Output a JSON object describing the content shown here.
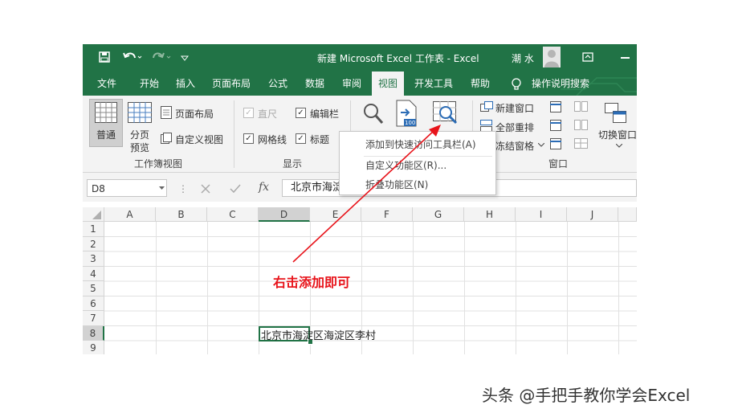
{
  "titlebar": {
    "title": "新建 Microsoft Excel 工作表 - Excel",
    "user": "潮 水"
  },
  "tabs": [
    {
      "label": "文件",
      "active": false
    },
    {
      "label": "开始",
      "active": false
    },
    {
      "label": "插入",
      "active": false
    },
    {
      "label": "页面布局",
      "active": false
    },
    {
      "label": "公式",
      "active": false
    },
    {
      "label": "数据",
      "active": false
    },
    {
      "label": "审阅",
      "active": false
    },
    {
      "label": "视图",
      "active": true
    },
    {
      "label": "开发工具",
      "active": false
    },
    {
      "label": "帮助",
      "active": false
    }
  ],
  "tell_me": "操作说明搜索",
  "ribbon": {
    "workbook_views": {
      "normal": "普通",
      "page_break_1": "分页",
      "page_break_2": "预览",
      "page_layout": "页面布局",
      "custom_views": "自定义视图",
      "group_label": "工作簿视图"
    },
    "show": {
      "ruler": "直尺",
      "formula_bar": "编辑栏",
      "gridlines": "网格线",
      "headings": "标题",
      "group_label": "显示"
    },
    "window": {
      "new_window": "新建窗口",
      "arrange_all": "全部重排",
      "freeze_panes": "冻结窗格",
      "switch_windows": "切换窗口",
      "group_label": "窗口"
    }
  },
  "context_menu": {
    "items": [
      "添加到快速访问工具栏(A)",
      "自定义功能区(R)...",
      "折叠功能区(N)"
    ]
  },
  "formula_bar": {
    "name_box": "D8",
    "fx_symbol": "fx",
    "content": "北京市海淀"
  },
  "sheet": {
    "columns": [
      "A",
      "B",
      "C",
      "D",
      "E",
      "F",
      "G",
      "H",
      "I",
      "J"
    ],
    "rows": [
      "1",
      "2",
      "3",
      "4",
      "5",
      "6",
      "7",
      "8",
      "9"
    ],
    "selected_cell": "D8",
    "cell_d8": "北京市海淀区海淀区李村"
  },
  "annotation": "右击添加即可",
  "watermark": "头条 @手把手教你学会Excel",
  "colors": {
    "excel_green": "#217346",
    "annotation_red": "#e8141b"
  }
}
